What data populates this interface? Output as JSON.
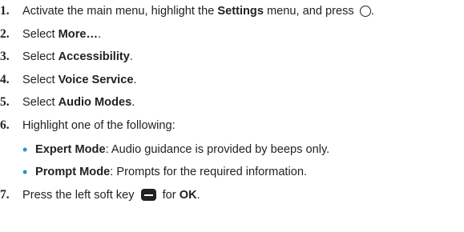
{
  "steps": [
    {
      "number": "1.",
      "pre": "Activate the main menu, highlight the ",
      "bold": "Settings",
      "post": " menu, and press ",
      "after_icon": ".",
      "icon": "circle-key-icon"
    },
    {
      "number": "2.",
      "pre": "Select ",
      "bold": "More…",
      "post": "."
    },
    {
      "number": "3.",
      "pre": "Select ",
      "bold": "Accessibility",
      "post": "."
    },
    {
      "number": "4.",
      "pre": "Select ",
      "bold": "Voice Service",
      "post": "."
    },
    {
      "number": "5.",
      "pre": "Select ",
      "bold": "Audio Modes",
      "post": "."
    },
    {
      "number": "6.",
      "pre": "Highlight one of the following:"
    },
    {
      "number": "7.",
      "pre": "Press the left soft key ",
      "post": " for ",
      "bold": "OK",
      "after_bold": ".",
      "icon": "left-soft-key-icon"
    }
  ],
  "options": [
    {
      "bold": "Expert Mode",
      "rest": ": Audio guidance is provided by beeps only."
    },
    {
      "bold": "Prompt Mode",
      "rest": ": Prompts for the required information."
    }
  ],
  "colors": {
    "text": "#222222",
    "bullet": "#2a8fd0"
  }
}
